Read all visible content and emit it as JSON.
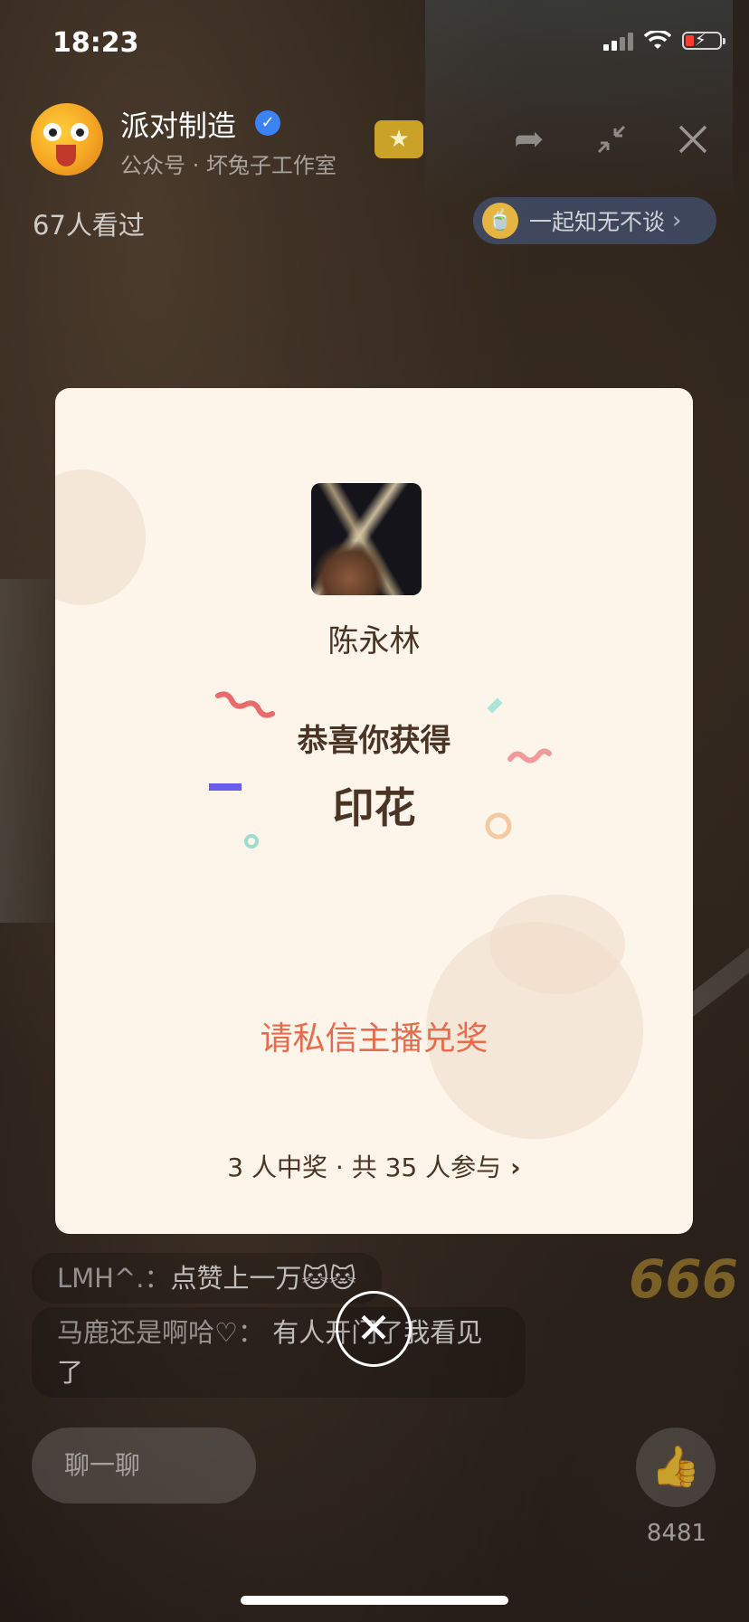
{
  "status_bar": {
    "time": "18:23"
  },
  "header": {
    "host_name": "派对制造",
    "host_subtitle": "公众号 · 坏兔子工作室",
    "viewer_count": "67人看过",
    "topic_pill": "一起知无不谈"
  },
  "chat": [
    {
      "user": "LMH^.",
      "text": "点赞上一万🐱🐱"
    },
    {
      "user": "马鹿还是啊哈♡",
      "text": "有人开门了我看见了"
    }
  ],
  "bottom": {
    "chat_placeholder": "聊一聊",
    "like_count": "8481",
    "deco_text": "666"
  },
  "modal": {
    "prize_giver": "陈永林",
    "congrats": "恭喜你获得",
    "prize": "印花",
    "redeem": "请私信主播兑奖",
    "participants": "3 人中奖 · 共 35 人参与"
  },
  "colors": {
    "modal_bg": "#fdf4ea",
    "accent": "#ea6b4c",
    "text_dark": "#4a3426"
  },
  "icons": [
    "verified-icon",
    "star-badge-icon",
    "share-icon",
    "minimize-icon",
    "close-icon",
    "tea-icon",
    "chevron-right-icon",
    "thumbs-up-icon",
    "close-circle-icon"
  ]
}
